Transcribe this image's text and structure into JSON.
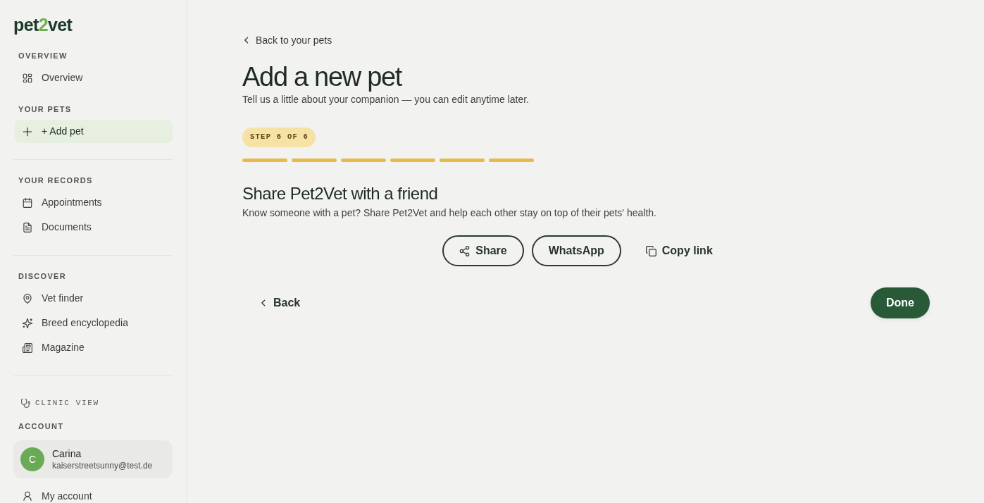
{
  "sidebar": {
    "logo": {
      "start": "pet",
      "accent": "2",
      "end": "vet"
    },
    "groups": [
      {
        "sections": [
          {
            "label": "OVERVIEW",
            "items": [
              {
                "label": "Overview",
                "kind": "dashboard",
                "selected": false
              }
            ]
          },
          {
            "label": "YOUR PETS",
            "items": [
              {
                "label": "+ Add pet",
                "kind": "add",
                "selected": true
              }
            ]
          }
        ]
      },
      {
        "sections": [
          {
            "label": "YOUR RECORDS",
            "items": [
              {
                "label": "Appointments",
                "kind": "calendar",
                "selected": false
              },
              {
                "label": "Documents",
                "kind": "document",
                "selected": false
              }
            ]
          }
        ]
      },
      {
        "sections": [
          {
            "label": "DISCOVER",
            "items": [
              {
                "label": "Vet finder",
                "kind": "location",
                "selected": false
              },
              {
                "label": "Breed encyclopedia",
                "kind": "breeds",
                "selected": false
              },
              {
                "label": "Magazine",
                "kind": "magazine",
                "selected": false
              }
            ]
          }
        ]
      }
    ],
    "clinic_view": {
      "label": "CLINIC VIEW"
    },
    "account": {
      "label": "ACCOUNT",
      "user": {
        "initial": "C",
        "name": "Carina",
        "email": "kaiserstreetsunny@test.de"
      },
      "items": [
        {
          "label": "My account",
          "kind": "profile",
          "selected": false
        }
      ]
    }
  },
  "main": {
    "back_link": "Back to your pets",
    "title": "Add a new pet",
    "subtitle": "Tell us a little about your companion — you can edit anytime later.",
    "stepper": {
      "badge": "STEP 6 OF 6",
      "steps": [
        {
          "complete": true
        },
        {
          "complete": true
        },
        {
          "complete": true
        },
        {
          "complete": true
        },
        {
          "complete": true
        },
        {
          "complete": true
        }
      ]
    },
    "share": {
      "title": "Share Pet2Vet with a friend",
      "description": "Know someone with a pet? Share Pet2Vet and help each other stay on top of their pets' health.",
      "actions": [
        {
          "label": "Share",
          "kind": "share"
        },
        {
          "label": "WhatsApp",
          "kind": "outlined"
        },
        {
          "label": "Copy link",
          "kind": "copy"
        }
      ]
    },
    "footer": {
      "back": "Back",
      "done": "Done"
    }
  }
}
